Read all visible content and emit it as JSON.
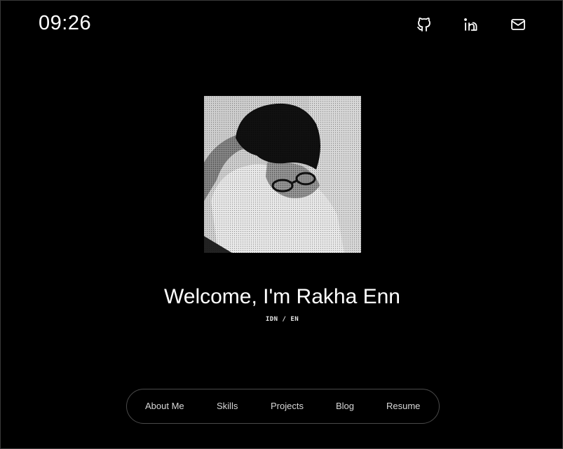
{
  "header": {
    "clock": "09:26",
    "social": [
      {
        "icon": "github-icon"
      },
      {
        "icon": "linkedin-icon"
      },
      {
        "icon": "mail-icon"
      }
    ]
  },
  "hero": {
    "title": "Welcome, I'm Rakha Enn",
    "language_toggle": "IDN / EN"
  },
  "nav": {
    "items": [
      {
        "label": "About Me"
      },
      {
        "label": "Skills"
      },
      {
        "label": "Projects"
      },
      {
        "label": "Blog"
      },
      {
        "label": "Resume"
      }
    ]
  },
  "colors": {
    "background": "#000000",
    "text": "#ffffff",
    "nav_text": "#d8d8d8",
    "nav_border": "#4a4a4a"
  }
}
